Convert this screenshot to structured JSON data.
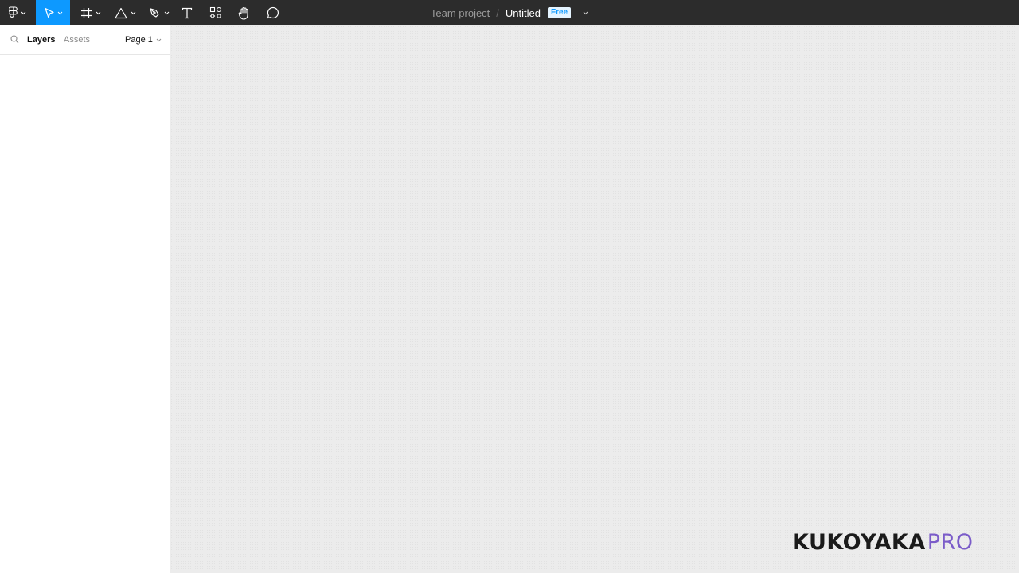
{
  "toolbar": {
    "tools": [
      {
        "name": "main-menu",
        "icon": "figma-logo-icon"
      },
      {
        "name": "move-tool",
        "icon": "move-arrow-icon",
        "active": true
      },
      {
        "name": "frame-tool",
        "icon": "frame-hash-icon"
      },
      {
        "name": "shape-tool",
        "icon": "triangle-icon"
      },
      {
        "name": "pen-tool",
        "icon": "pen-icon"
      },
      {
        "name": "text-tool",
        "icon": "text-icon"
      },
      {
        "name": "resources-tool",
        "icon": "resources-icon"
      },
      {
        "name": "hand-tool",
        "icon": "hand-icon"
      },
      {
        "name": "comment-tool",
        "icon": "comment-icon"
      }
    ],
    "project": "Team project",
    "separator": "/",
    "file_name": "Untitled",
    "plan_badge": "Free",
    "accent_color": "#0d99ff",
    "bar_color": "#2c2c2c"
  },
  "left_panel": {
    "tabs": [
      {
        "label": "Layers",
        "active": true
      },
      {
        "label": "Assets",
        "active": false
      }
    ],
    "page_selector": "Page 1"
  },
  "watermark": {
    "main": "KUKOYAKA",
    "suffix": "PRO",
    "suffix_color": "#7b5cc9"
  }
}
